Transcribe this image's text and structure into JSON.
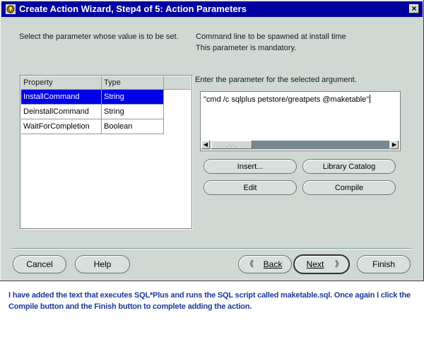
{
  "window": {
    "title": "Create Action Wizard, Step4 of 5: Action Parameters",
    "close_glyph": "×"
  },
  "left_instruction": "Select the parameter whose value is to be set.",
  "right_description": {
    "line1": "Command line to be spawned at install time",
    "line2": "This parameter is mandatory."
  },
  "param_table": {
    "headers": [
      "Property",
      "Type"
    ],
    "rows": [
      {
        "property": "InstallCommand",
        "type": "String",
        "selected": true
      },
      {
        "property": "DeinstallCommand",
        "type": "String",
        "selected": false
      },
      {
        "property": "WaitForCompletion",
        "type": "Boolean",
        "selected": false
      }
    ]
  },
  "value_prompt": "Enter the parameter for the selected argument.",
  "value_field": {
    "value": "\"cmd /c sqlplus petstore/greatpets @maketable\""
  },
  "editor_buttons": {
    "insert": "Insert...",
    "library_catalog": "Library Catalog",
    "edit": "Edit",
    "compile": "Compile"
  },
  "footer_buttons": {
    "cancel": "Cancel",
    "help": "Help",
    "back": "Back",
    "next": "Next",
    "finish": "Finish"
  },
  "caption": "I have added the text that executes SQL*Plus and runs the SQL script called maketable.sql. Once again I click the Compile button and the Finish button to complete adding the action.",
  "colors": {
    "title_bar": "#0000a0",
    "dialog_bg": "#d0d8d4",
    "selection": "#0000e8",
    "caption_text": "#1a3a9c"
  },
  "icons": [
    "wizard-icon",
    "close-icon",
    "scroll-left-icon",
    "scroll-right-icon",
    "back-arrow-icon",
    "next-arrow-icon"
  ]
}
